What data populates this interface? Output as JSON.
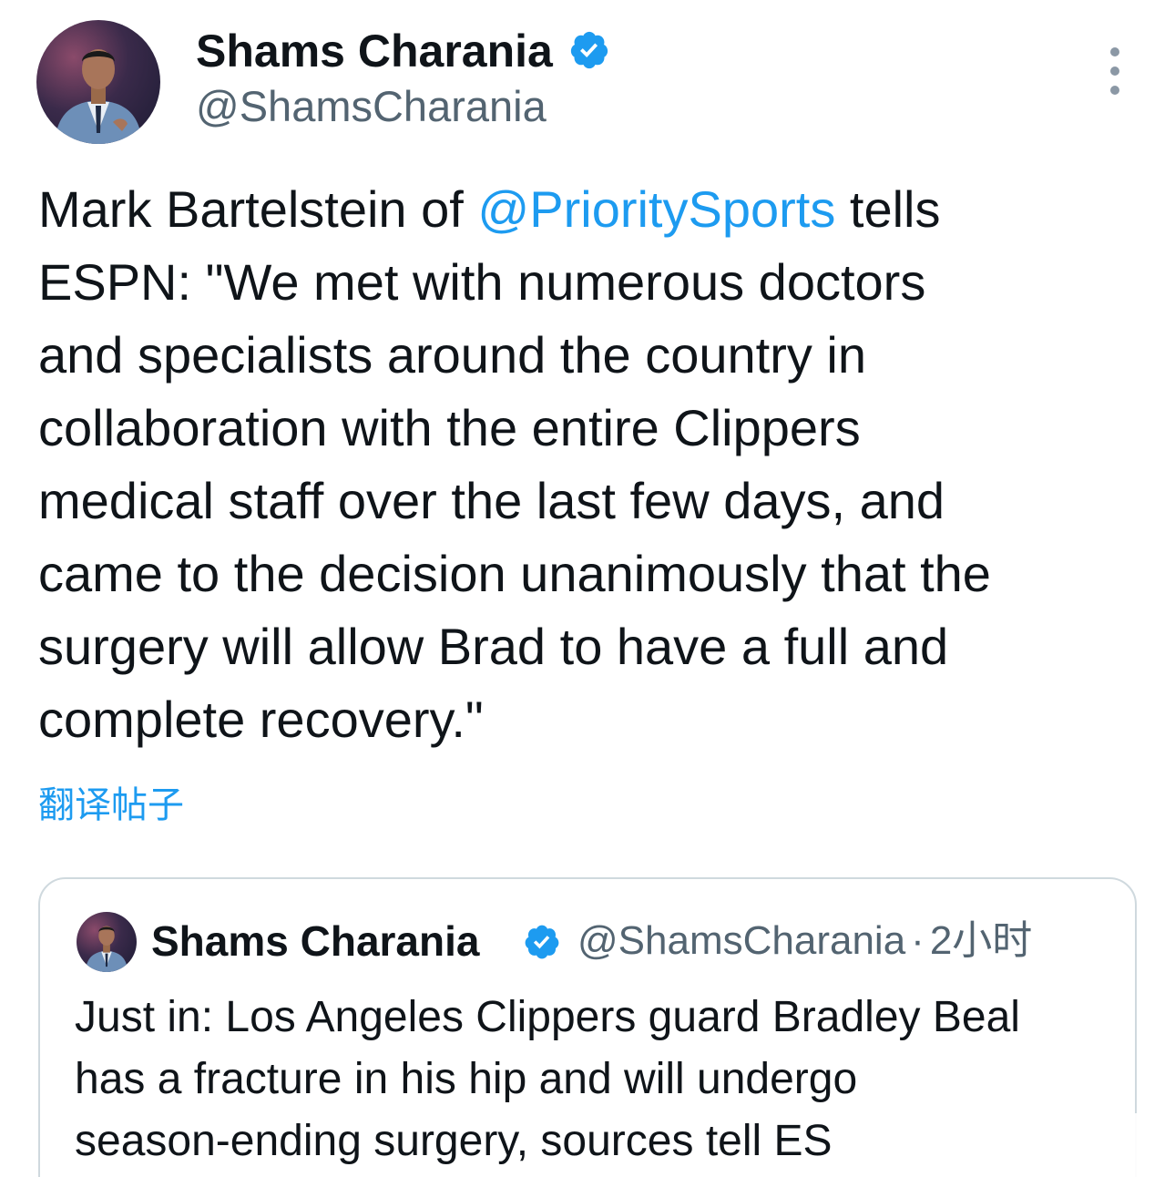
{
  "author": {
    "name": "Shams Charania",
    "handle": "@ShamsCharania",
    "verified": true
  },
  "tweet": {
    "lines": [
      {
        "pre": "Mark Bartelstein of ",
        "mention": "@PrioritySports",
        "post": " tells"
      },
      {
        "text": "ESPN: \"We met with numerous doctors"
      },
      {
        "text": "and specialists around the country in"
      },
      {
        "text": "collaboration with the entire Clippers"
      },
      {
        "text": "medical staff over the last few days, and"
      },
      {
        "text": "came to the decision unanimously that the"
      },
      {
        "text": "surgery will allow Brad to have a full and"
      },
      {
        "text": "complete recovery.\""
      }
    ]
  },
  "translate_label": "翻译帖子",
  "quoted": {
    "name": "Shams Charania",
    "handle": "@ShamsCharania",
    "separator": "·",
    "time": "2小时",
    "lines": [
      "Just in: Los Angeles Clippers guard Bradley Beal",
      "has a fracture in his hip and will undergo",
      "season-ending surgery, sources tell ES"
    ]
  },
  "colors": {
    "link": "#1d9bf0",
    "verified": "#1d9bf0",
    "secondary_text": "#536471",
    "border": "#cfd9de"
  },
  "icons": {
    "verified": "verified-badge-icon",
    "more": "more-options-icon"
  }
}
